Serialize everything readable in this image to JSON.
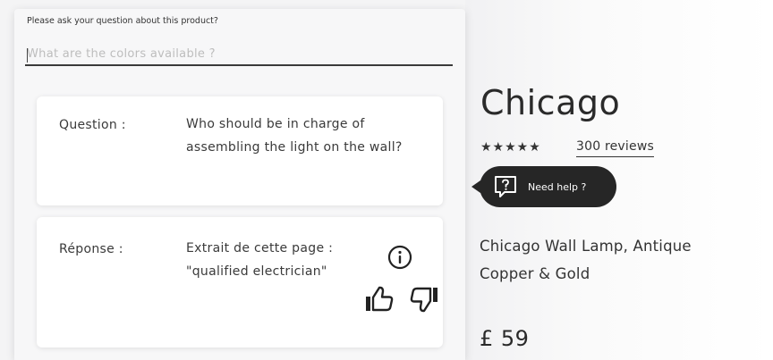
{
  "qa": {
    "prompt_label": "Please ask your question about this product?",
    "input_placeholder": "What are the colors available ?",
    "question_label": "Question :",
    "question_text": "Who should be in charge of assembling the light on the wall?",
    "answer_label": "Réponse :",
    "answer_text": "Extrait de cette page : \"qualified electrician\""
  },
  "product": {
    "title": "Chicago",
    "stars": "★★★★★",
    "rating": 5,
    "reviews_label": "300 reviews",
    "help_label": "Need help ?",
    "description": "Chicago Wall Lamp, Antique Copper & Gold",
    "price": "£ 59"
  },
  "icons": {
    "info": "info-icon",
    "thumb_up": "thumbs-up-icon",
    "thumb_down": "thumbs-down-icon",
    "help": "question-bubble-icon"
  },
  "colors": {
    "pill_bg": "#262626",
    "text_dark": "#2a2a2a",
    "panel_bg": "#f7f7f8"
  }
}
